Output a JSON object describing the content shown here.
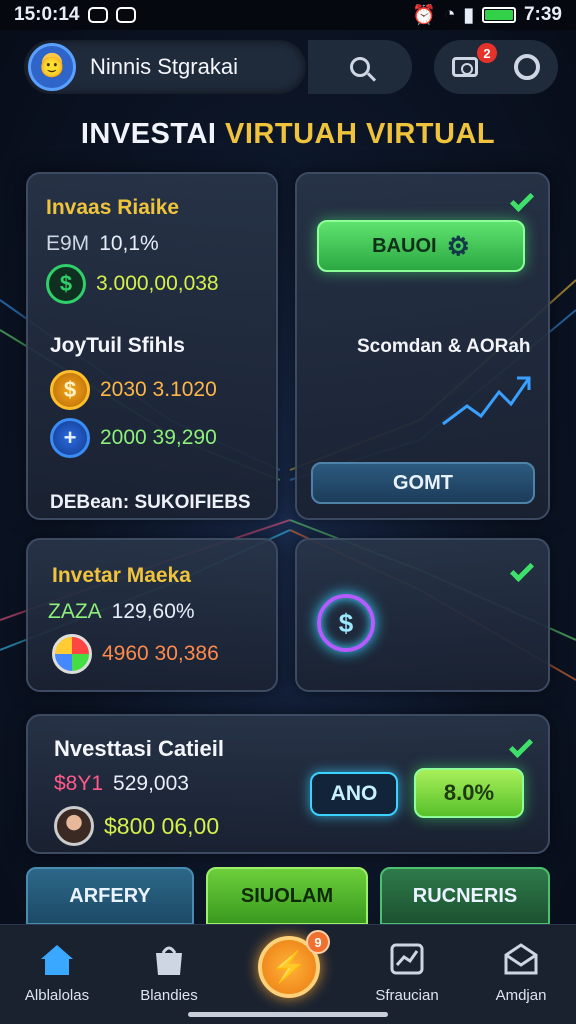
{
  "status_bar": {
    "time_left": "15:0:14",
    "time_right": "7:39"
  },
  "header": {
    "profile_name": "Ninnis Stgrakai",
    "notification_count": "2"
  },
  "title": {
    "part1": "INVESTAI",
    "part2": "VIRTUAH VIRTUAL"
  },
  "card_invest": {
    "title": "Invaas Riaike",
    "rate_label": "E9M",
    "rate_value": "10,1%",
    "balance": "3.000,00,038",
    "subtitle": "JoyTuil Sfihls",
    "gold_value": "2030 3.1020",
    "blue_value": "2000 39,290",
    "footer": "DEBean: SUKOIFIEBS"
  },
  "card_action": {
    "button_label": "BAUOI",
    "caption": "Scomdan & AORah",
    "secondary_label": "GOMT"
  },
  "card_market": {
    "title": "Invetar Maeka",
    "rate_label": "ZAZA",
    "rate_value": "129,60%",
    "value": "4960 30,386"
  },
  "card_capital": {
    "title": "Nvesttasi Catieil",
    "label": "$8Y1",
    "value1": "529,003",
    "value2": "$800 06,00",
    "pill_blue": "ANO",
    "pill_green": "8.0%"
  },
  "bottom_buttons": [
    "ARFERY",
    "SIUOLAM",
    "RUCNERIS"
  ],
  "nav": [
    {
      "label": "Alblalolas",
      "icon": "home-icon"
    },
    {
      "label": "Blandies",
      "icon": "bag-icon"
    },
    {
      "label": "Sfraucian",
      "icon": "chart-icon"
    },
    {
      "label": "Amdjan",
      "icon": "mail-icon"
    }
  ],
  "fab_badge": "9",
  "colors": {
    "accent_gold": "#f0c33c",
    "accent_green": "#3fe06a",
    "neon_blue": "#3ad2ff"
  }
}
